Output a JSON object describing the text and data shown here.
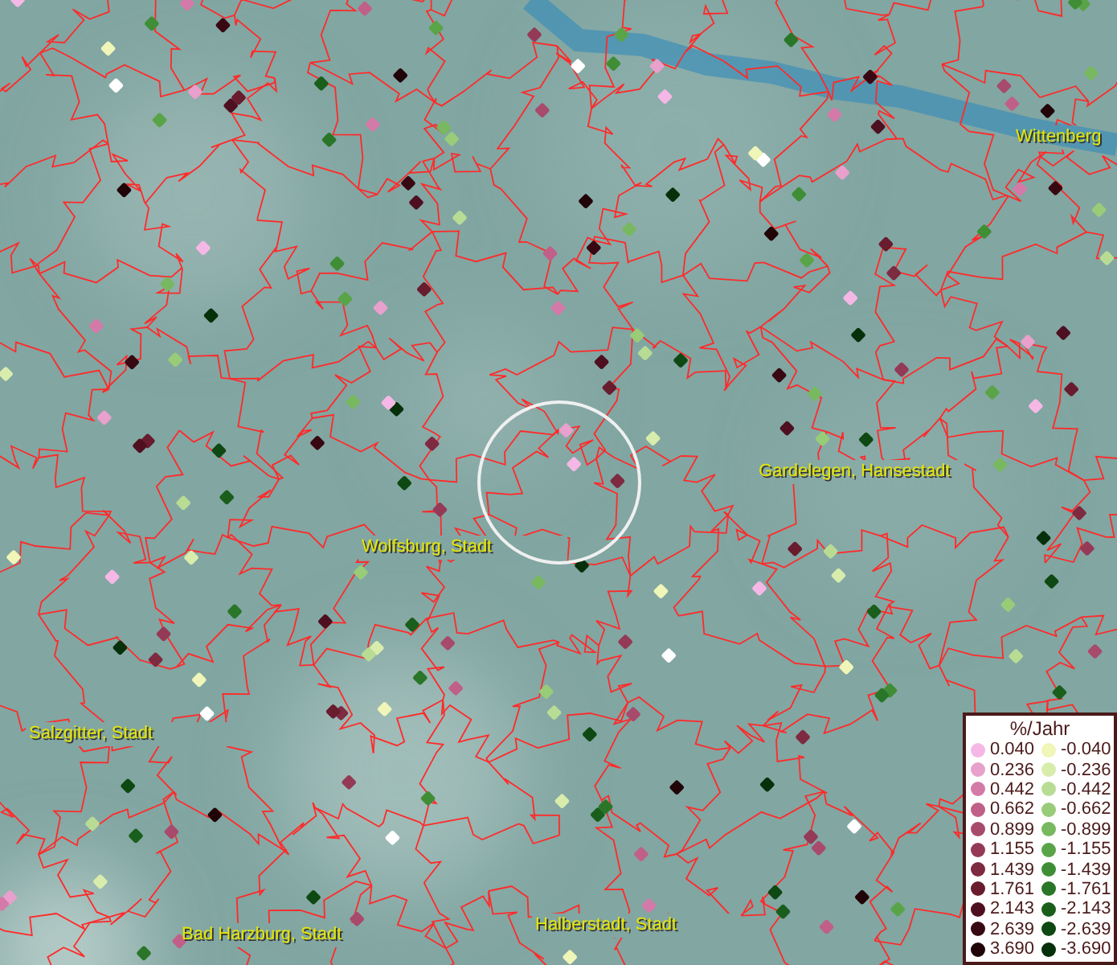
{
  "map": {
    "places": [
      {
        "name": "Wittenberg"
      },
      {
        "name": "Gardelegen, Hansestadt"
      },
      {
        "name": "Wolfsburg, Stadt"
      },
      {
        "name": "Salzgitter, Stadt"
      },
      {
        "name": "Bad Harzburg, Stadt"
      },
      {
        "name": "Halberstadt, Stadt"
      }
    ]
  },
  "legend": {
    "title": "%/Jahr",
    "positive": [
      {
        "label": "0.040",
        "color": "#f5b8e6"
      },
      {
        "label": "0.236",
        "color": "#e8a0cc"
      },
      {
        "label": "0.442",
        "color": "#d47aa8"
      },
      {
        "label": "0.662",
        "color": "#c06088"
      },
      {
        "label": "0.899",
        "color": "#a84a6c"
      },
      {
        "label": "1.155",
        "color": "#943a56"
      },
      {
        "label": "1.439",
        "color": "#7e2a40"
      },
      {
        "label": "1.761",
        "color": "#681c2e"
      },
      {
        "label": "2.143",
        "color": "#4e1020"
      },
      {
        "label": "2.639",
        "color": "#380812"
      },
      {
        "label": "3.690",
        "color": "#200408"
      }
    ],
    "negative": [
      {
        "label": "-0.040",
        "color": "#f0f5b8"
      },
      {
        "label": "-0.236",
        "color": "#d8ecac"
      },
      {
        "label": "-0.442",
        "color": "#b8dc94"
      },
      {
        "label": "-0.662",
        "color": "#98cc78"
      },
      {
        "label": "-0.899",
        "color": "#78b860"
      },
      {
        "label": "-1.155",
        "color": "#5aa448"
      },
      {
        "label": "-1.439",
        "color": "#3f8e36"
      },
      {
        "label": "-1.761",
        "color": "#2a7628"
      },
      {
        "label": "-2.143",
        "color": "#1a5e1c"
      },
      {
        "label": "-2.639",
        "color": "#0e4812"
      },
      {
        "label": "-3.690",
        "color": "#06300a"
      }
    ]
  }
}
